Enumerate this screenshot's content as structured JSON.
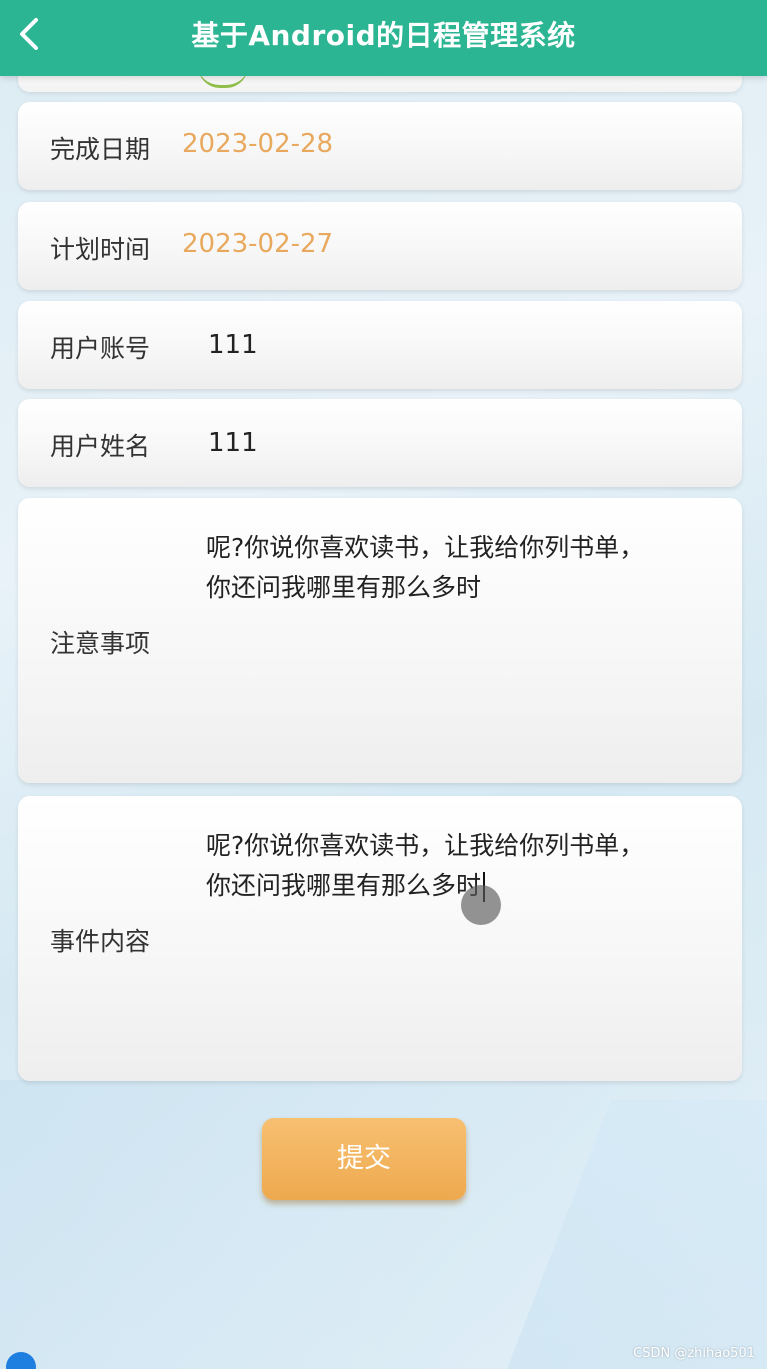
{
  "header": {
    "title": "基于Android的日程管理系统",
    "back_icon": "chevron-left-icon",
    "color": "#2bb592"
  },
  "form": {
    "completion_date": {
      "label": "完成日期",
      "value": "2023-02-28"
    },
    "plan_time": {
      "label": "计划时间",
      "value": "2023-02-27"
    },
    "user_account": {
      "label": "用户账号",
      "value": "111"
    },
    "user_name": {
      "label": "用户姓名",
      "value": "111"
    },
    "notes": {
      "label": "注意事项",
      "line1": "呢?你说你喜欢读书，让我给你列书单，",
      "line2": "你还问我哪里有那么多时"
    },
    "event_content": {
      "label": "事件内容",
      "line1": "呢?你说你喜欢读书，让我给你列书单，",
      "line2": "你还问我哪里有那么多时"
    }
  },
  "submit": {
    "label": "提交",
    "color": "#eea94e"
  },
  "watermark": "CSDN @zhihao501",
  "colors": {
    "date_value": "#e8a95e",
    "background": "#dcebf3"
  }
}
